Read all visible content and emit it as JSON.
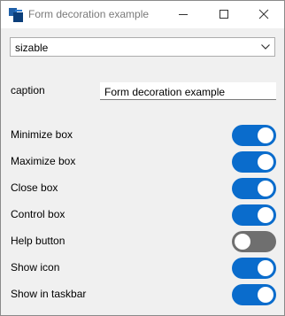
{
  "window": {
    "title": "Form decoration example"
  },
  "border_style": {
    "selected": "sizable"
  },
  "caption": {
    "label": "caption",
    "value": "Form decoration example"
  },
  "toggles": [
    {
      "label": "Minimize box",
      "on": true
    },
    {
      "label": "Maximize box",
      "on": true
    },
    {
      "label": "Close box",
      "on": true
    },
    {
      "label": "Control box",
      "on": true
    },
    {
      "label": "Help button",
      "on": false
    },
    {
      "label": "Show icon",
      "on": true
    },
    {
      "label": "Show in taskbar",
      "on": true
    }
  ],
  "colors": {
    "toggle_on": "#0a6ccc",
    "toggle_off": "#6f6f6f"
  }
}
